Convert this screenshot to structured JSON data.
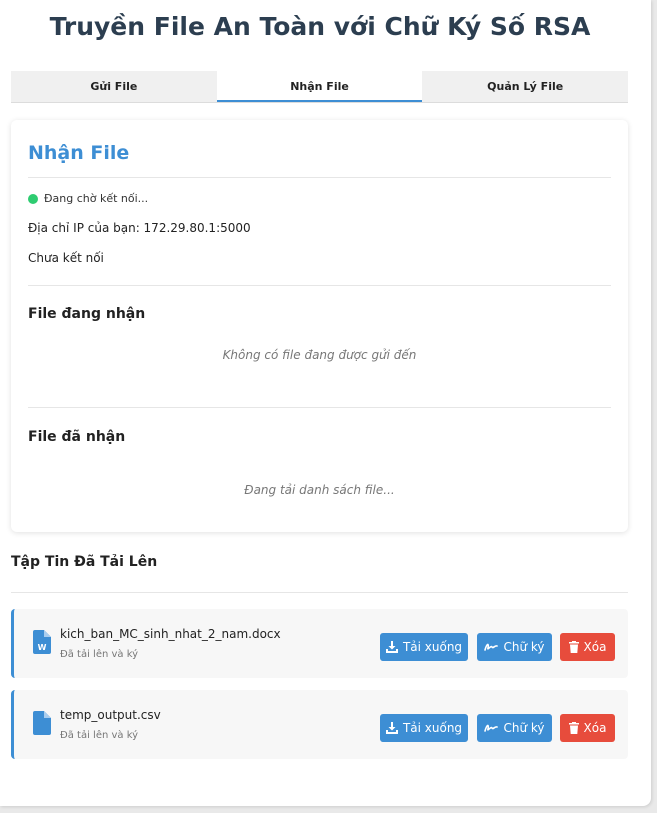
{
  "header": {
    "title": "Truyền File An Toàn với Chữ Ký Số RSA"
  },
  "tabs": [
    {
      "label": "Gửi File",
      "active": false
    },
    {
      "label": "Nhận File",
      "active": true
    },
    {
      "label": "Quản Lý File",
      "active": false
    }
  ],
  "receive": {
    "title": "Nhận File",
    "status": {
      "text": "Đang chờ kết nối...",
      "color": "#2ecc71"
    },
    "ip_line": "Địa chỉ IP của bạn: 172.29.80.1:5000",
    "connection": "Chưa kết nối",
    "incoming": {
      "title": "File đang nhận",
      "empty": "Không có file đang được gửi đến"
    },
    "received": {
      "title": "File đã nhận",
      "empty": "Đang tải danh sách file..."
    }
  },
  "uploads": {
    "title": "Tập Tin Đã Tải Lên",
    "files": [
      {
        "name": "kich_ban_MC_sinh_nhat_2_nam.docx",
        "status": "Đã tải lên và ký",
        "icon": "word-file-icon"
      },
      {
        "name": "temp_output.csv",
        "status": "Đã tải lên và ký",
        "icon": "file-icon"
      }
    ],
    "actions": {
      "download": "Tải xuống",
      "sign": "Chữ ký",
      "delete": "Xóa"
    }
  },
  "colors": {
    "accent": "#3d8ed4",
    "danger": "#e74c3c",
    "success": "#2ecc71"
  }
}
